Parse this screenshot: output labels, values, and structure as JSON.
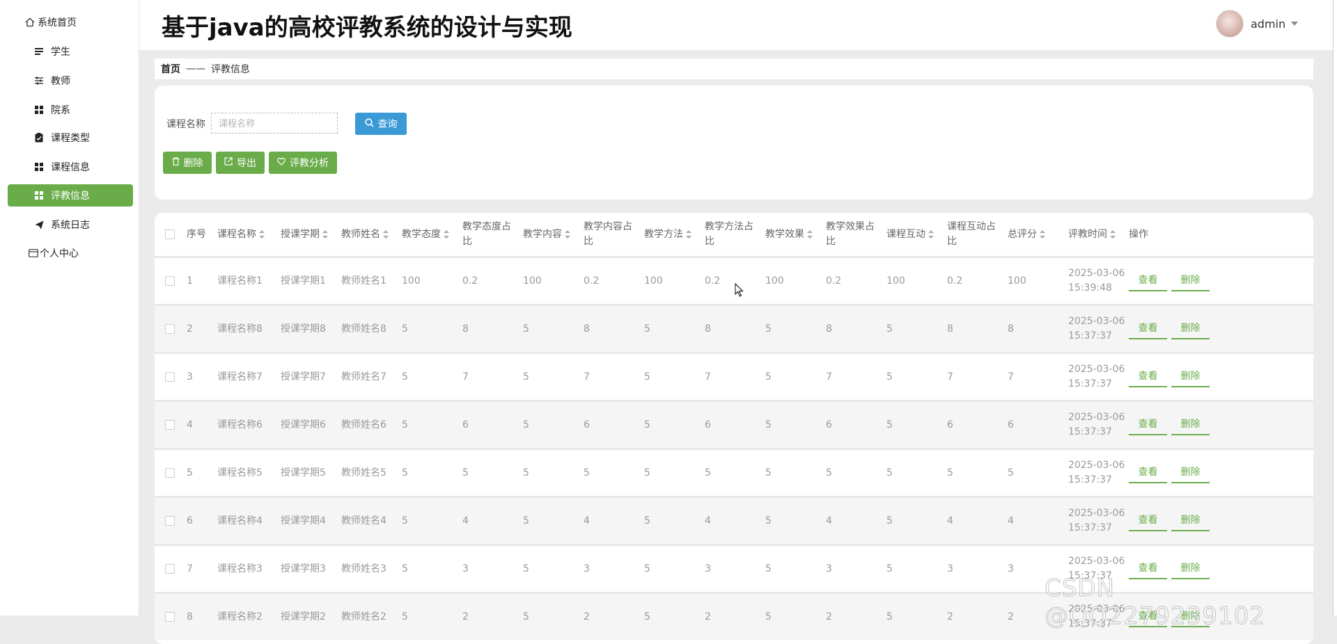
{
  "sidebar": {
    "items": [
      {
        "label": "系统首页",
        "icon": "home-icon"
      },
      {
        "label": "学生",
        "icon": "list-icon"
      },
      {
        "label": "教师",
        "icon": "sliders-icon"
      },
      {
        "label": "院系",
        "icon": "grid-icon"
      },
      {
        "label": "课程类型",
        "icon": "clipboard-icon"
      },
      {
        "label": "课程信息",
        "icon": "grid-icon"
      },
      {
        "label": "评教信息",
        "icon": "grid-icon",
        "active": true
      },
      {
        "label": "系统日志",
        "icon": "send-icon"
      },
      {
        "label": "个人中心",
        "icon": "card-icon"
      }
    ]
  },
  "header": {
    "title": "基于java的高校评教系统的设计与实现",
    "user": "admin"
  },
  "breadcrumb": {
    "home": "首页",
    "separator": "——",
    "current": "评教信息"
  },
  "search": {
    "label": "课程名称",
    "placeholder": "课程名称",
    "value": "",
    "button": "查询"
  },
  "actions": {
    "delete": "删除",
    "export": "导出",
    "analysis": "评教分析"
  },
  "table": {
    "columns": [
      "序号",
      "课程名称",
      "授课学期",
      "教师姓名",
      "教学态度",
      "教学态度占比",
      "教学内容",
      "教学内容占比",
      "教学方法",
      "教学方法占比",
      "教学效果",
      "教学效果占比",
      "课程互动",
      "课程互动占比",
      "总评分",
      "评教时间",
      "操作"
    ],
    "row_actions": {
      "view": "查看",
      "delete": "删除"
    },
    "rows": [
      [
        "1",
        "课程名称1",
        "授课学期1",
        "教师姓名1",
        "100",
        "0.2",
        "100",
        "0.2",
        "100",
        "0.2",
        "100",
        "0.2",
        "100",
        "0.2",
        "100",
        "2025-03-06 15:39:48"
      ],
      [
        "2",
        "课程名称8",
        "授课学期8",
        "教师姓名8",
        "5",
        "8",
        "5",
        "8",
        "5",
        "8",
        "5",
        "8",
        "5",
        "8",
        "8",
        "2025-03-06 15:37:37"
      ],
      [
        "3",
        "课程名称7",
        "授课学期7",
        "教师姓名7",
        "5",
        "7",
        "5",
        "7",
        "5",
        "7",
        "5",
        "7",
        "5",
        "7",
        "7",
        "2025-03-06 15:37:37"
      ],
      [
        "4",
        "课程名称6",
        "授课学期6",
        "教师姓名6",
        "5",
        "6",
        "5",
        "6",
        "5",
        "6",
        "5",
        "6",
        "5",
        "6",
        "6",
        "2025-03-06 15:37:37"
      ],
      [
        "5",
        "课程名称5",
        "授课学期5",
        "教师姓名5",
        "5",
        "5",
        "5",
        "5",
        "5",
        "5",
        "5",
        "5",
        "5",
        "5",
        "5",
        "2025-03-06 15:37:37"
      ],
      [
        "6",
        "课程名称4",
        "授课学期4",
        "教师姓名4",
        "5",
        "4",
        "5",
        "4",
        "5",
        "4",
        "5",
        "4",
        "5",
        "4",
        "4",
        "2025-03-06 15:37:37"
      ],
      [
        "7",
        "课程名称3",
        "授课学期3",
        "教师姓名3",
        "5",
        "3",
        "5",
        "3",
        "5",
        "3",
        "5",
        "3",
        "5",
        "3",
        "3",
        "2025-03-06 15:37:37"
      ],
      [
        "8",
        "课程名称2",
        "授课学期2",
        "教师姓名2",
        "5",
        "2",
        "5",
        "2",
        "5",
        "2",
        "5",
        "2",
        "5",
        "2",
        "2",
        "2025-03-06 15:37:37"
      ]
    ]
  },
  "watermark": "CSDN @QQ2279239102",
  "colors": {
    "accent": "#6aac49",
    "query": "#3a9ad6"
  }
}
